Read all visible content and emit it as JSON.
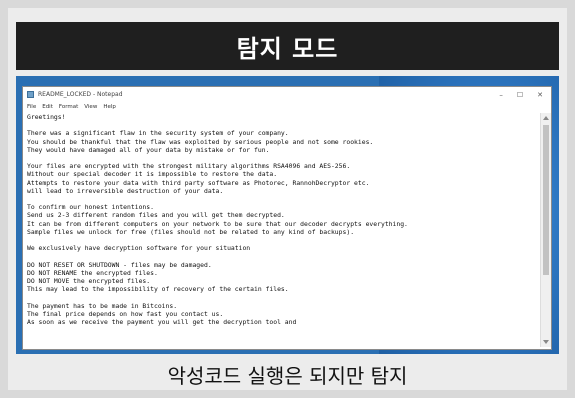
{
  "header": {
    "title": "탐지 모드"
  },
  "notepad": {
    "window_title": "README_LOCKED - Notepad",
    "controls": [
      "–",
      "☐",
      "✕"
    ],
    "menu": [
      "File",
      "Edit",
      "Format",
      "View",
      "Help"
    ],
    "lines": [
      "Greetings!",
      "",
      "There was a significant flaw in the security system of your company.",
      "You should be thankful that the flaw was exploited by serious people and not some rookies.",
      "They would have damaged all of your data by mistake or for fun.",
      "",
      "Your files are encrypted with the strongest military algorithms RSA4096 and AES-256.",
      "Without our special decoder it is impossible to restore the data.",
      "Attempts to restore your data with third party software as Photorec, RannohDecryptor etc.",
      "will lead to irreversible destruction of your data.",
      "",
      "To confirm our honest intentions.",
      "Send us 2-3 different random files and you will get them decrypted.",
      "It can be from different computers on your network to be sure that our decoder decrypts everything.",
      "Sample files we unlock for free (files should not be related to any kind of backups).",
      "",
      "We exclusively have decryption software for your situation",
      "",
      "DO NOT RESET OR SHUTDOWN - files may be damaged.",
      "DO NOT RENAME the encrypted files.",
      "DO NOT MOVE the encrypted files.",
      "This may lead to the impossibility of recovery of the certain files.",
      "",
      "The payment has to be made in Bitcoins.",
      "The final price depends on how fast you contact us.",
      "As soon as we receive the payment you will get the decryption tool and"
    ]
  },
  "caption": {
    "text": "악성코드 실행은 되지만 탐지"
  }
}
